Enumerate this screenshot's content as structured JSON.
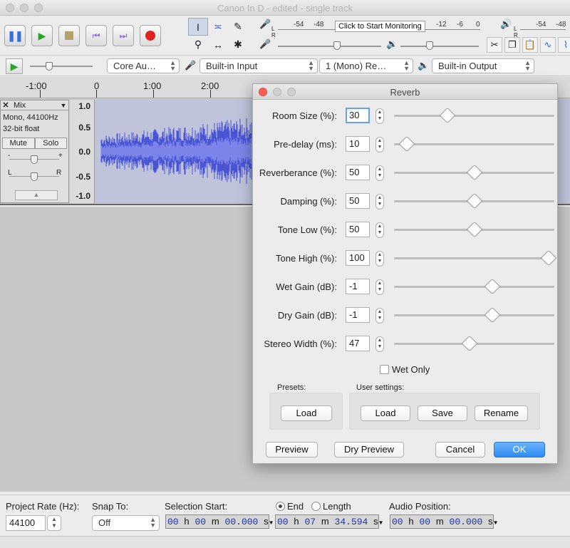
{
  "window": {
    "title": "Canon In D - edited - single track"
  },
  "meters": {
    "record_scale": [
      "-54",
      "-48",
      "-12",
      "-6",
      "0"
    ],
    "monitor_label": "Click to Start Monitoring",
    "play_scale": [
      "-54",
      "-48"
    ]
  },
  "device_toolbar": {
    "host": "Core Au…",
    "input_device": "Built-in Input",
    "channels": "1 (Mono) Re…",
    "output_device": "Built-in Output"
  },
  "ruler": {
    "labels": [
      "-1:00",
      "0",
      "1:00",
      "2:00"
    ]
  },
  "track": {
    "name": "Mix",
    "format": "Mono, 44100Hz",
    "bit_depth": "32-bit float",
    "mute_label": "Mute",
    "solo_label": "Solo",
    "gain_minus": "-",
    "gain_plus": "+",
    "pan_left": "L",
    "pan_right": "R",
    "scale": [
      "1.0",
      "0.5",
      "0.0",
      "-0.5",
      "-1.0"
    ]
  },
  "reverb": {
    "title": "Reverb",
    "params": [
      {
        "label": "Room Size (%):",
        "value": "30",
        "level": 0.32
      },
      {
        "label": "Pre-delay (ms):",
        "value": "10",
        "level": 0.05
      },
      {
        "label": "Reverberance (%):",
        "value": "50",
        "level": 0.5
      },
      {
        "label": "Damping (%):",
        "value": "50",
        "level": 0.5
      },
      {
        "label": "Tone Low (%):",
        "value": "50",
        "level": 0.5
      },
      {
        "label": "Tone High (%):",
        "value": "100",
        "level": 1.0
      },
      {
        "label": "Wet Gain (dB):",
        "value": "-1",
        "level": 0.62
      },
      {
        "label": "Dry Gain (dB):",
        "value": "-1",
        "level": 0.62
      },
      {
        "label": "Stereo Width (%):",
        "value": "47",
        "level": 0.47
      }
    ],
    "wet_only_label": "Wet Only",
    "presets_label": "Presets:",
    "presets_load": "Load",
    "user_settings_label": "User settings:",
    "user_load": "Load",
    "user_save": "Save",
    "user_rename": "Rename",
    "preview": "Preview",
    "dry_preview": "Dry Preview",
    "cancel": "Cancel",
    "ok": "OK"
  },
  "selection_bar": {
    "project_rate_label": "Project Rate (Hz):",
    "project_rate": "44100",
    "snap_to_label": "Snap To:",
    "snap_to": "Off",
    "selection_start_label": "Selection Start:",
    "selection_start": {
      "h": "00",
      "m": "00",
      "s": "00.000"
    },
    "end_label": "End",
    "length_label": "Length",
    "selection_end": {
      "h": "00",
      "m": "07",
      "s": "34.594"
    },
    "audio_position_label": "Audio Position:",
    "audio_position": {
      "h": "00",
      "m": "00",
      "s": "00.000"
    },
    "unit_h": "h",
    "unit_m": "m",
    "unit_s": "s"
  }
}
